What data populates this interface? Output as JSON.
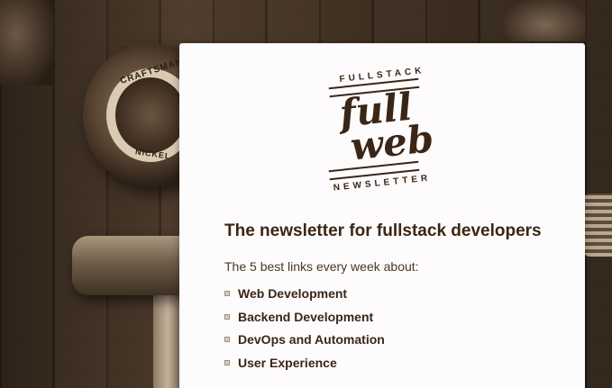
{
  "logo": {
    "top_text": "FULLSTACK",
    "word1": "full",
    "word2": "web",
    "bottom_text": "NEWSLETTER"
  },
  "background": {
    "tape_brand": "CRAFTSMAN",
    "tape_model": "NICKEL"
  },
  "content": {
    "headline": "The newsletter for fullstack developers",
    "intro": "The 5 best links every week about:",
    "topics": [
      "Web Development",
      "Backend Development",
      "DevOps and Automation",
      "User Experience"
    ]
  },
  "colors": {
    "text_dark": "#3a2616",
    "card_bg": "#fdfbfb"
  }
}
